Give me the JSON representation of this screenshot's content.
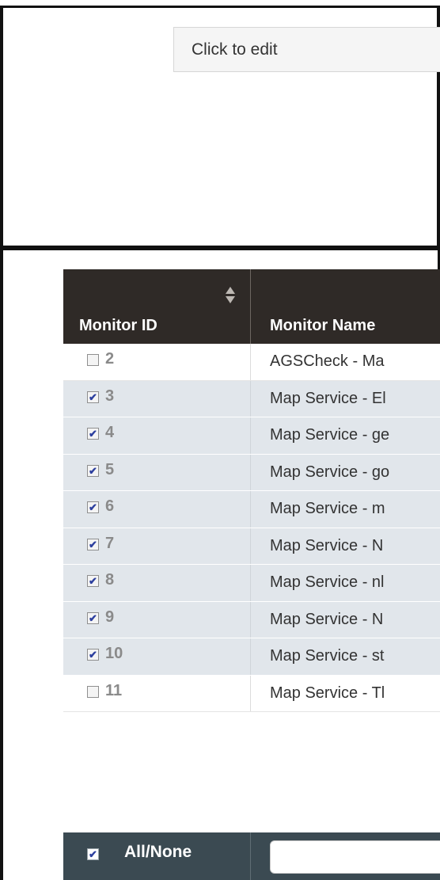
{
  "editor": {
    "placeholder_text": "Click to edit"
  },
  "table": {
    "headers": {
      "monitor_id": "Monitor ID",
      "monitor_name": "Monitor Name"
    },
    "rows": [
      {
        "id": "2",
        "name": "AGSCheck - Ma",
        "checked": false
      },
      {
        "id": "3",
        "name": "Map Service - El",
        "checked": true
      },
      {
        "id": "4",
        "name": "Map Service - ge",
        "checked": true
      },
      {
        "id": "5",
        "name": "Map Service - go",
        "checked": true
      },
      {
        "id": "6",
        "name": "Map Service - m",
        "checked": true
      },
      {
        "id": "7",
        "name": "Map Service - N",
        "checked": true
      },
      {
        "id": "8",
        "name": "Map Service - nl",
        "checked": true
      },
      {
        "id": "9",
        "name": "Map Service - N",
        "checked": true
      },
      {
        "id": "10",
        "name": "Map Service - st",
        "checked": true
      },
      {
        "id": "11",
        "name": "Map Service - Tl",
        "checked": false
      }
    ],
    "footer": {
      "all_none_label": "All/None",
      "all_none_checked": true,
      "filter_value": ""
    }
  },
  "colors": {
    "header_bg": "#2f2a27",
    "checked_row_bg": "#e1e6eb",
    "footer_bg": "#3b4a52"
  }
}
